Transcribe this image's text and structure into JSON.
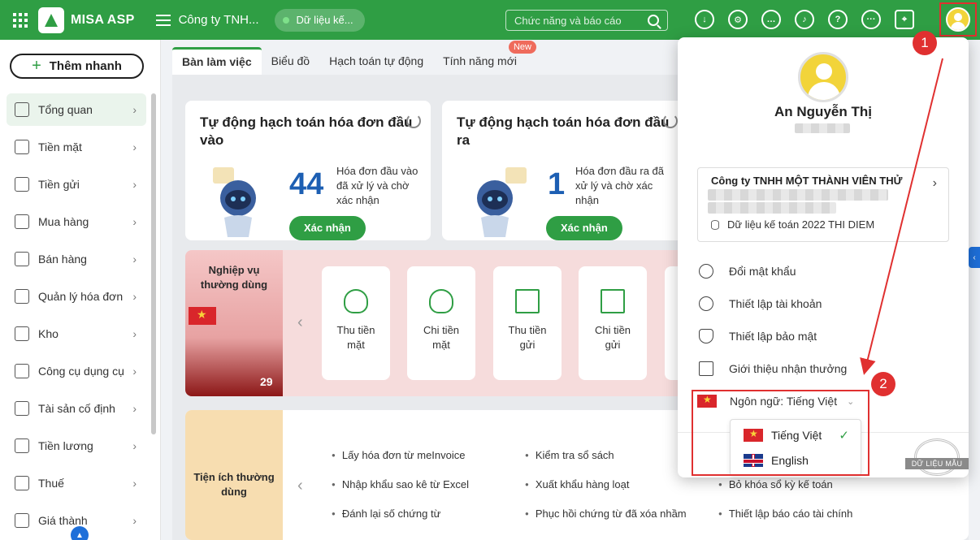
{
  "topbar": {
    "brand": "MISA ASP",
    "company_short": "Công ty TNH...",
    "data_pill": "Dữ liệu kế...",
    "search_placeholder": "Chức năng và báo cáo",
    "icons": [
      "download-icon",
      "gear-icon",
      "chat-icon",
      "bell-icon",
      "help-icon",
      "more-icon",
      "map-pin-icon",
      "avatar-icon"
    ]
  },
  "sidebar": {
    "quick_add": "Thêm nhanh",
    "items": [
      {
        "label": "Tổng quan",
        "icon": "dashboard-icon"
      },
      {
        "label": "Tiền mặt",
        "icon": "cash-bag-icon"
      },
      {
        "label": "Tiền gửi",
        "icon": "bank-icon"
      },
      {
        "label": "Mua hàng",
        "icon": "shopping-bag-icon"
      },
      {
        "label": "Bán hàng",
        "icon": "cart-icon"
      },
      {
        "label": "Quản lý hóa đơn",
        "icon": "invoice-icon"
      },
      {
        "label": "Kho",
        "icon": "warehouse-icon"
      },
      {
        "label": "Công cụ dụng cụ",
        "icon": "tools-icon"
      },
      {
        "label": "Tài sản cố định",
        "icon": "car-icon"
      },
      {
        "label": "Tiền lương",
        "icon": "payroll-icon"
      },
      {
        "label": "Thuế",
        "icon": "tax-icon"
      },
      {
        "label": "Giá thành",
        "icon": "price-tag-icon"
      }
    ]
  },
  "tabs": [
    {
      "label": "Bàn làm việc"
    },
    {
      "label": "Biểu đồ"
    },
    {
      "label": "Hạch toán tự động"
    },
    {
      "label": "Tính năng mới",
      "badge": "New"
    }
  ],
  "cards": [
    {
      "title": "Tự động hạch toán hóa đơn đầu vào",
      "count": "44",
      "desc": "Hóa đơn đầu vào đã xử lý và chờ xác nhận",
      "button": "Xác nhận"
    },
    {
      "title": "Tự động hạch toán hóa đơn đầu ra",
      "count": "1",
      "desc": "Hóa đơn đầu ra đã xử lý và chờ xác nhận",
      "button": "Xác nhận"
    }
  ],
  "operations": {
    "title": "Nghiệp vụ thường dùng",
    "banner_number": "29",
    "tiles": [
      {
        "label": "Thu tiền mặt",
        "icon": "money-bag-icon"
      },
      {
        "label": "Chi tiền mặt",
        "icon": "money-bag-icon"
      },
      {
        "label": "Thu tiền gửi",
        "icon": "bank-icon"
      },
      {
        "label": "Chi tiền gửi",
        "icon": "bank-icon"
      }
    ]
  },
  "utilities": {
    "title": "Tiện ích thường dùng",
    "items": [
      "Lấy hóa đơn từ meInvoice",
      "Kiểm tra sổ sách",
      "Nhập khẩu sao kê từ Excel",
      "Xuất khẩu hàng loạt",
      "Bỏ khóa sổ kỳ kế toán",
      "Đánh lại số chứng từ",
      "Phục hồi chứng từ đã xóa nhầm",
      "Thiết lập báo cáo tài chính"
    ]
  },
  "account_panel": {
    "user_name": "An Nguyễn Thị",
    "company_name": "Công ty TNHH MỘT THÀNH VIÊN THỬ",
    "database": "Dữ liệu kế toán 2022 THI DIEM",
    "menu": [
      {
        "label": "Đổi mật khẩu",
        "icon": "key-icon"
      },
      {
        "label": "Thiết lập tài khoản",
        "icon": "user-circle-icon"
      },
      {
        "label": "Thiết lập bảo mật",
        "icon": "shield-icon"
      },
      {
        "label": "Giới thiệu nhận thưởng",
        "icon": "gift-icon"
      }
    ],
    "language_label": "Ngôn ngữ: Tiếng Việt",
    "languages": [
      {
        "label": "Tiếng Việt",
        "selected": true
      },
      {
        "label": "English",
        "selected": false
      }
    ]
  },
  "annotations": {
    "step1": "1",
    "step2": "2",
    "color": "#e03030"
  },
  "watermark": "DỮ LIỆU MẪU",
  "colors": {
    "brand_green": "#2f9e44",
    "accent_blue": "#1d5fb3",
    "badge_red": "#ef6b5c"
  }
}
